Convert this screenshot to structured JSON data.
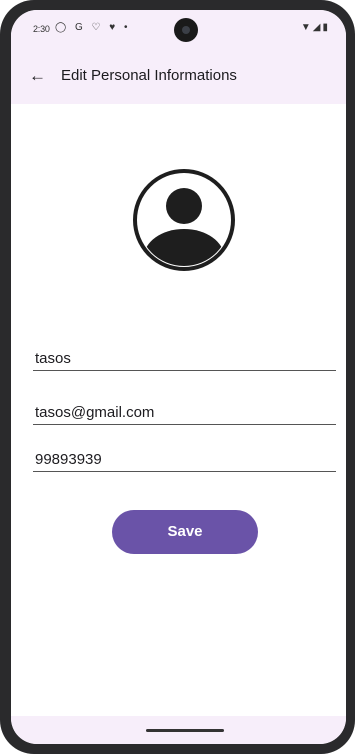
{
  "status_bar": {
    "time": "2:30",
    "left_icons": "◯ G ♡ ♥ •",
    "right_icons": "▼◢▮"
  },
  "app_bar": {
    "back_icon": "←",
    "title": "Edit Personal Informations"
  },
  "avatar": {
    "icon": "account-circle-icon"
  },
  "form": {
    "name_value": "tasos",
    "email_value": "tasos@gmail.com",
    "phone_value": "99893939"
  },
  "actions": {
    "save_label": "Save"
  },
  "colors": {
    "primary": "#6a53a8",
    "bar_background": "#f7eefa"
  }
}
